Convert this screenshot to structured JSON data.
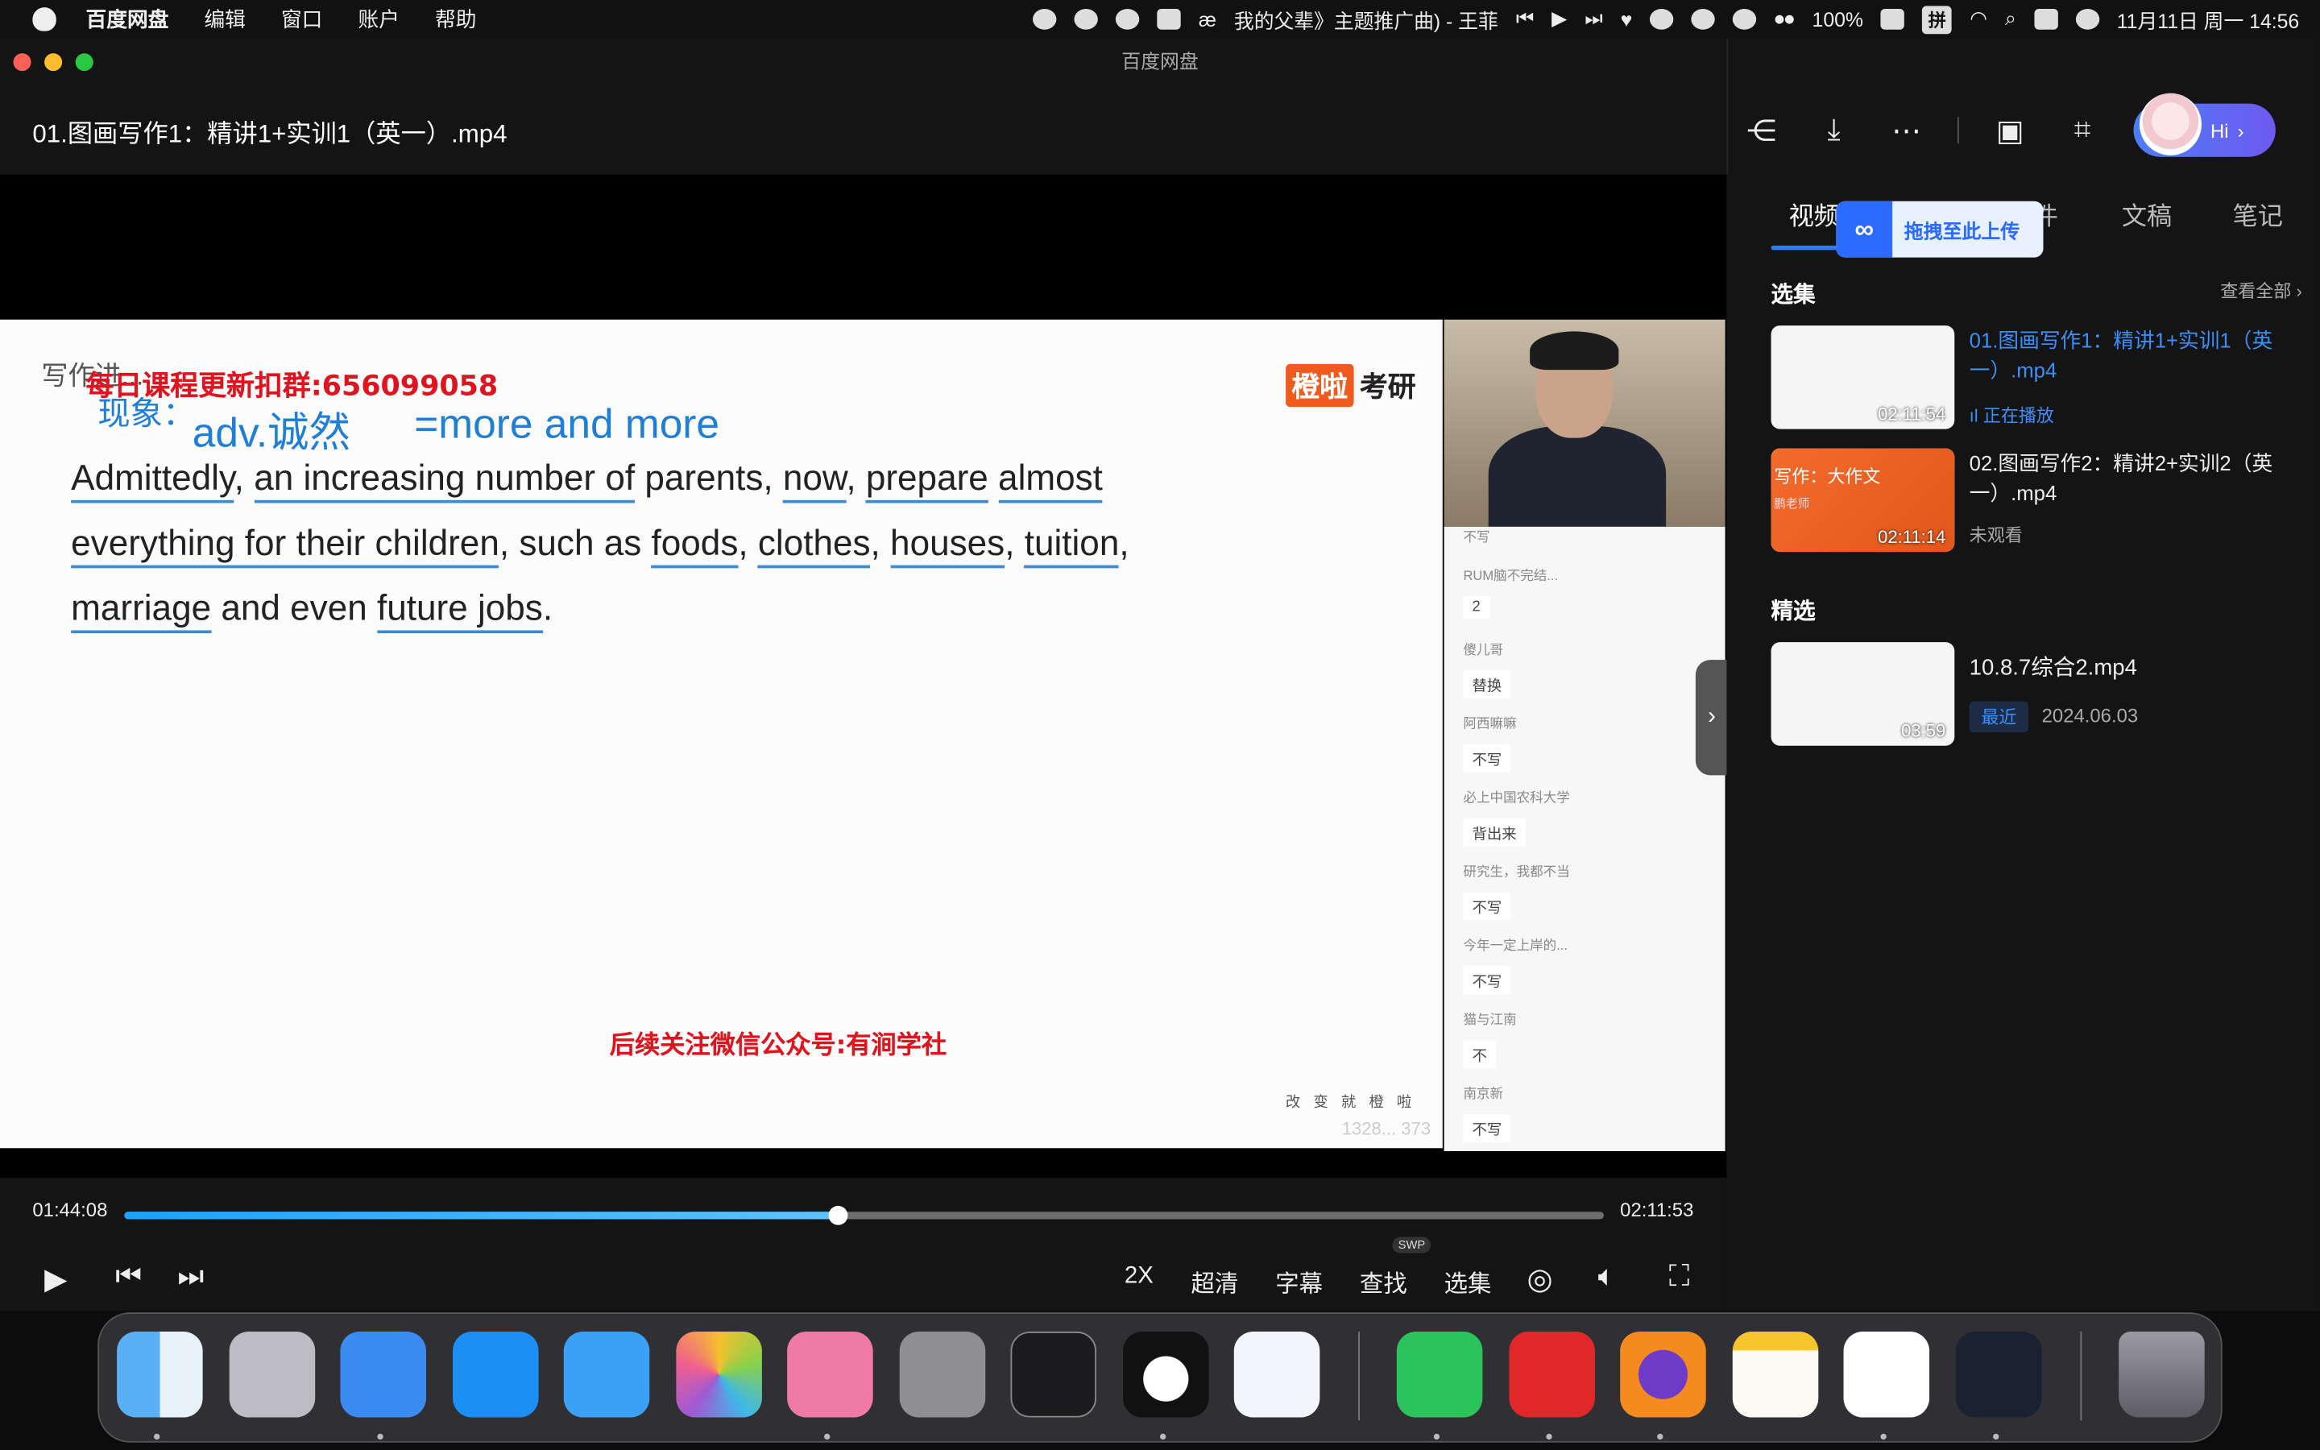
{
  "menubar": {
    "app": "百度网盘",
    "menus": [
      "编辑",
      "窗口",
      "账户",
      "帮助"
    ],
    "now_playing": "我的父辈》主题推广曲) - 王菲",
    "battery": "100%",
    "ime": "拼",
    "datetime": "11月11日 周一  14:56"
  },
  "window": {
    "title": "百度网盘",
    "file_title": "01.图画写作1：精讲1+实训1（英一）.mp4",
    "hi_label": "Hi"
  },
  "slide": {
    "top_text": "写作进...",
    "notice1": "每日课程更新扣群:656099058",
    "brand1": "橙啦",
    "brand2": "考研",
    "hw_word1": "现象：",
    "hw_word2": "adv.诚然",
    "hw_word3": "=more and more",
    "sentence_parts": [
      "Admittedly",
      ", ",
      "an increasing number of",
      " parents, ",
      "now",
      ", ",
      "prepare",
      " ",
      "almost",
      " ",
      "everything for their children",
      ", such as ",
      "foods",
      ", ",
      "clothes",
      ", ",
      "houses",
      ", ",
      "tuition",
      ", ",
      "marriage",
      " and even ",
      "future jobs",
      "."
    ],
    "notice2": "后续关注微信公众号:有涧学社",
    "slogan": "改 变 就 橙 啦",
    "footer_num": "1328... 373"
  },
  "chat": [
    {
      "name": "不写",
      "msg": ""
    },
    {
      "name": "RUM脑不完结...",
      "msg": "2"
    },
    {
      "name": "傻儿哥",
      "msg": "替换"
    },
    {
      "name": "阿西嘛嘛",
      "msg": "不写"
    },
    {
      "name": "必上中国农科大学",
      "msg": "背出来"
    },
    {
      "name": "研究生，我都不当",
      "msg": "不写"
    },
    {
      "name": "今年一定上岸的...",
      "msg": "不写"
    },
    {
      "name": "猫与江南",
      "msg": "不"
    },
    {
      "name": "南京新",
      "msg": "不写"
    }
  ],
  "player": {
    "current_time": "01:44:08",
    "total_time": "02:11:53",
    "progress": 0.482,
    "speed": "2X",
    "quality": "超清",
    "subtitle": "字幕",
    "search": "查找",
    "search_badge": "SWP",
    "episodes": "选集"
  },
  "side": {
    "tabs": [
      "视频",
      "文件",
      "文稿",
      "笔记"
    ],
    "drag_tip": "拖拽至此上传",
    "section1": "选集",
    "see_all": "查看全部",
    "items": [
      {
        "title": "01.图画写作1：精讲1+实训1（英一）.mp4",
        "duration": "02:11:54",
        "status": "正在播放"
      },
      {
        "title": "02.图画写作2：精讲2+实训2（英一）.mp4",
        "duration": "02:11:14",
        "status": "未观看",
        "thumb_text": "写作：大作文",
        "thumb_sub": "鹏老师"
      }
    ],
    "section2": "精选",
    "featured": {
      "title": "10.8.7综合2.mp4",
      "duration": "03:59",
      "tag": "最近",
      "date": "2024.06.03"
    }
  },
  "dock": [
    "finder",
    "launchpad",
    "safari",
    "app-store",
    "mail",
    "photos",
    "bilibili",
    "system-settings",
    "terminal",
    "qq",
    "vscode",
    "wechat",
    "netease-music",
    "firefox",
    "notes",
    "baidu-netdisk",
    "stocks",
    "trash"
  ],
  "colors": {
    "accent": "#2f7cf6",
    "progress": "#1aa3ff",
    "red_notice": "#e0141e"
  }
}
